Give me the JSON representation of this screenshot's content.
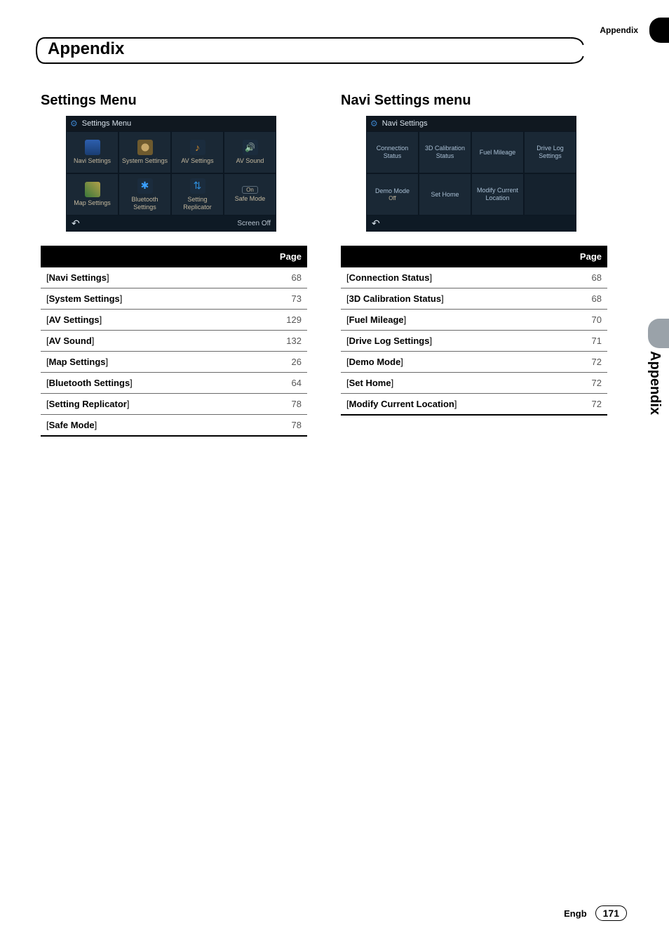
{
  "header": {
    "section_label": "Appendix",
    "chapter_title": "Appendix"
  },
  "side": {
    "tab_label": "Appendix"
  },
  "footer": {
    "lang": "Engb",
    "page": "171"
  },
  "left": {
    "title": "Settings Menu",
    "screen": {
      "title": "Settings Menu",
      "cells": [
        "Navi Settings",
        "System Settings",
        "AV Settings",
        "AV Sound",
        "Map Settings",
        "Bluetooth Settings",
        "Setting Replicator",
        "Safe Mode"
      ],
      "safe_badge": "On",
      "footer_right": "Screen Off"
    },
    "table_header": "Page",
    "rows": [
      {
        "name": "Navi Settings",
        "page": "68"
      },
      {
        "name": "System Settings",
        "page": "73"
      },
      {
        "name": "AV Settings",
        "page": "129"
      },
      {
        "name": "AV Sound",
        "page": "132"
      },
      {
        "name": "Map Settings",
        "page": "26"
      },
      {
        "name": "Bluetooth Settings",
        "page": "64"
      },
      {
        "name": "Setting Replicator",
        "page": "78"
      },
      {
        "name": "Safe Mode",
        "page": "78"
      }
    ]
  },
  "right": {
    "title_a": "Navi Settings",
    "title_b": " menu",
    "screen": {
      "title": "Navi Settings",
      "cells": [
        "Connection Status",
        "3D Calibration Status",
        "Fuel Mileage",
        "Drive Log Settings",
        "Demo Mode",
        "Set Home",
        "Modify Current Location",
        ""
      ],
      "demo_sub": "Off"
    },
    "table_header": "Page",
    "rows": [
      {
        "name": "Connection Status",
        "page": "68"
      },
      {
        "name": "3D Calibration Status",
        "page": "68"
      },
      {
        "name": "Fuel Mileage",
        "page": "70"
      },
      {
        "name": "Drive Log Settings",
        "page": "71"
      },
      {
        "name": "Demo Mode",
        "page": "72"
      },
      {
        "name": "Set Home",
        "page": "72"
      },
      {
        "name": "Modify Current Location",
        "page": "72"
      }
    ]
  }
}
